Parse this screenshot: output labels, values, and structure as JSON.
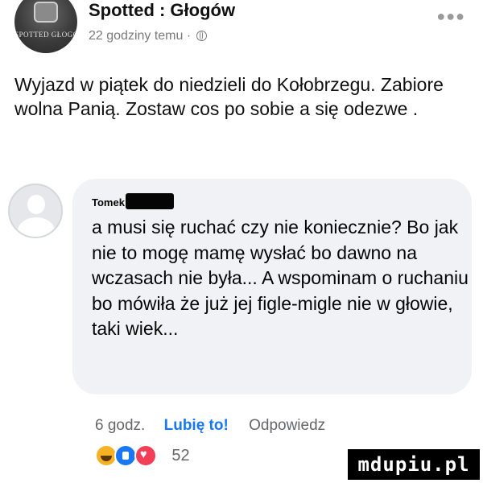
{
  "post": {
    "page_name": "Spotted : Głogów",
    "avatar_text": "SPOTTED GŁOGÓW",
    "timestamp": "22 godziny temu",
    "separator": "·",
    "body": "Wyjazd w piątek do niedzieli do Kołobrzegu. Zabiore wolna Panią.  Zostaw cos po sobie a się odezwe ."
  },
  "comment": {
    "author": "Tomek",
    "text": "a musi się ruchać czy nie koniecznie? Bo jak nie to mogę mamę wysłać bo dawno na wczasach nie była... A wspominam o ruchaniu bo mówiła że już jej figle-migle nie w głowie, taki wiek...",
    "time": "6 godz.",
    "like_label": "Lubię to!",
    "reply_label": "Odpowiedz",
    "reaction_count": "52"
  },
  "icons": {
    "more": "more-options-icon",
    "globe": "globe-icon",
    "reactions": [
      "haha-icon",
      "like-icon",
      "love-icon"
    ]
  },
  "colors": {
    "like": "#1877f2",
    "bubble": "#f0f2f5",
    "meta_text": "#65676b"
  },
  "watermark": "mdupiu.pl"
}
